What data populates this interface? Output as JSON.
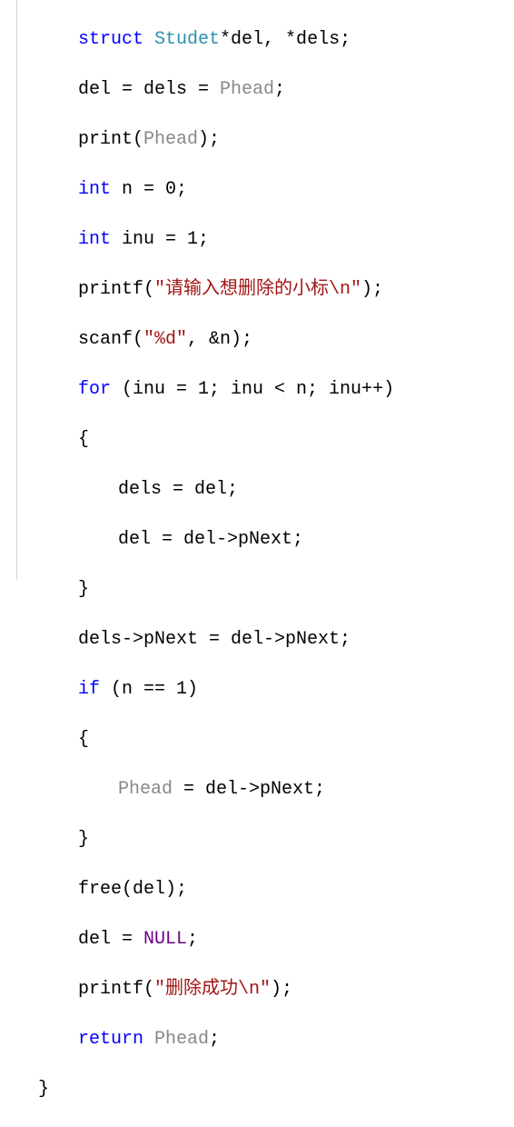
{
  "code": {
    "l1": {
      "kw": "struct",
      "type": "Studet",
      "rest": "*del, *dels;"
    },
    "l2": {
      "a": "del = dels = ",
      "fade": "Phead",
      "b": ";"
    },
    "l3": {
      "a": "print(",
      "fade": "Phead",
      "b": ");"
    },
    "l4": {
      "kw": "int",
      "rest": " n = 0;"
    },
    "l5": {
      "kw": "int",
      "rest": " inu = 1;"
    },
    "l6": {
      "a": "printf(",
      "str": "\"请输入想删除的小标\\n\"",
      "b": ");"
    },
    "l7": {
      "a": "scanf(",
      "str": "\"%d\"",
      "b": ", &n);"
    },
    "l8": {
      "kw": "for",
      "rest": " (inu = 1; inu < n; inu++)"
    },
    "l9": "{",
    "l10": "dels = del;",
    "l11": "del = del->pNext;",
    "l12": "}",
    "l13": "dels->pNext = del->pNext;",
    "l14": {
      "kw": "if",
      "rest": " (n == 1)"
    },
    "l15": "{",
    "l16": {
      "fade": "Phead",
      "rest": " = del->pNext;"
    },
    "l17": "}",
    "l18": "free(del);",
    "l19": {
      "a": "del = ",
      "def": "NULL",
      "b": ";"
    },
    "l20": {
      "a": "printf(",
      "str": "\"删除成功\\n\"",
      "b": ");"
    },
    "l21": {
      "kw": "return",
      "fade": " Phead",
      "rest": ";"
    },
    "l22": "}"
  }
}
